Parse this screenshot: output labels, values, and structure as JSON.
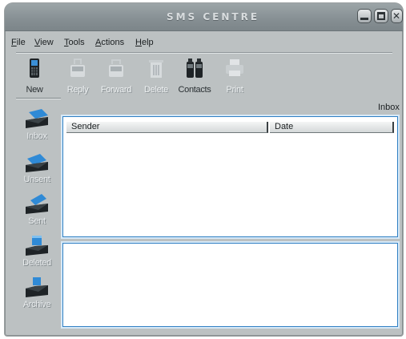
{
  "window": {
    "title": "SMS CENTRE",
    "controls": {
      "minimize_icon": "minimize-icon",
      "maximize_icon": "maximize-icon",
      "close_glyph": "✕"
    }
  },
  "menu": {
    "items": [
      {
        "label": "File"
      },
      {
        "label": "View"
      },
      {
        "label": "Tools"
      },
      {
        "label": "Actions"
      },
      {
        "label": "Help"
      }
    ]
  },
  "toolbar": {
    "buttons": [
      {
        "label": "New",
        "icon": "phone-new-icon",
        "enabled": true
      },
      {
        "label": "Reply",
        "icon": "reply-icon",
        "enabled": false
      },
      {
        "label": "Forward",
        "icon": "forward-icon",
        "enabled": false
      },
      {
        "label": "Delete",
        "icon": "trash-icon",
        "enabled": false
      },
      {
        "label": "Contacts",
        "icon": "contacts-icon",
        "enabled": true
      },
      {
        "label": "Print",
        "icon": "printer-icon",
        "enabled": false
      }
    ]
  },
  "sidebar": {
    "items": [
      {
        "label": "Inbox",
        "icon": "inbox-tray-icon"
      },
      {
        "label": "Unsent",
        "icon": "unsent-tray-icon"
      },
      {
        "label": "Sent",
        "icon": "sent-tray-icon"
      },
      {
        "label": "Deleted",
        "icon": "deleted-bin-icon"
      },
      {
        "label": "Archive",
        "icon": "archive-box-icon"
      }
    ]
  },
  "main": {
    "folder_title": "Inbox",
    "columns": [
      "Sender",
      "Date"
    ],
    "rows": []
  },
  "colors": {
    "window_bg": "#bcc1c2",
    "accent_blue": "#2f7fc3",
    "device_dark": "#1e2326"
  }
}
